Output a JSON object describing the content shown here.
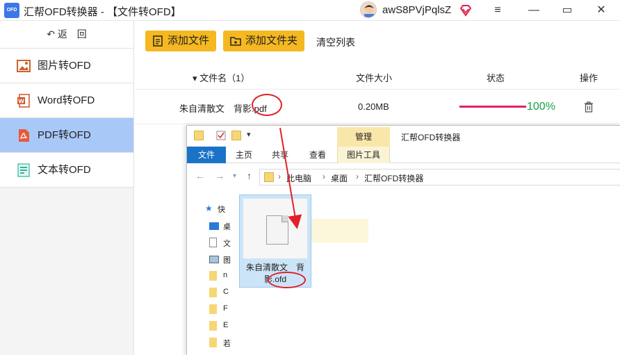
{
  "titlebar": {
    "app_icon_text": "OFD",
    "title": "汇帮OFD转换器 - 【文件转OFD】",
    "username": "awS8PVjPqlsZ",
    "minimize_glyph": "—",
    "maximize_glyph": "▭",
    "close_glyph": "✕"
  },
  "sidebar": {
    "back_label": "返　回",
    "items": [
      {
        "label": "图片转OFD",
        "icon": "image-icon"
      },
      {
        "label": "Word转OFD",
        "icon": "word-icon"
      },
      {
        "label": "PDF转OFD",
        "icon": "pdf-icon",
        "active": true
      },
      {
        "label": "文本转OFD",
        "icon": "text-doc-icon"
      }
    ]
  },
  "toolbar": {
    "add_file_label": "添加文件",
    "add_folder_label": "添加文件夹",
    "clear_list_label": "清空列表"
  },
  "table": {
    "headers": {
      "filename": "▾ 文件名（1）",
      "size": "文件大小",
      "status": "状态",
      "action": "操作"
    },
    "rows": [
      {
        "name": "朱自清散文　背影.pdf",
        "size": "0.20MB",
        "progress": 100,
        "percent_label": "100%"
      }
    ]
  },
  "explorer": {
    "title": "汇帮OFD转换器",
    "manage_tab": "管理",
    "ribbon_tabs": [
      "文件",
      "主页",
      "共享",
      "查看",
      "图片工具"
    ],
    "breadcrumb": [
      "此电脑",
      "桌面",
      "汇帮OFD转换器"
    ],
    "tree_labels": [
      "快",
      "桌",
      "文",
      "图",
      "n",
      "C",
      "F",
      "E",
      "若"
    ],
    "file_name": "朱自清散文　背影.ofd"
  },
  "colors": {
    "accent_yellow": "#f5b820",
    "active_nav": "#a8c8f8",
    "progress": "#e0206a",
    "percent_green": "#1aa14a",
    "annotation_red": "#e0202a"
  }
}
